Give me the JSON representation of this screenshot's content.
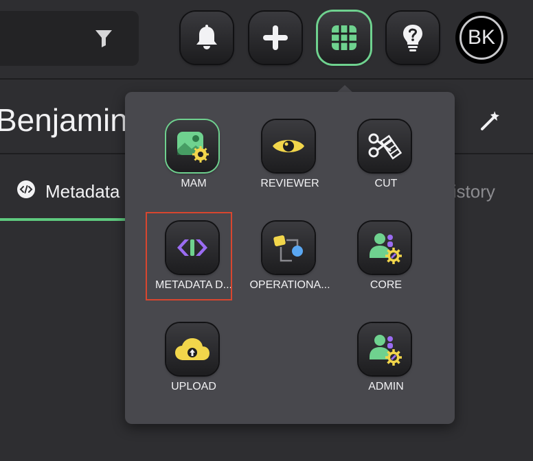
{
  "topbar": {
    "filter_icon": "filter-icon",
    "buttons": [
      {
        "name": "notifications-button",
        "icon": "bell-icon"
      },
      {
        "name": "add-button",
        "icon": "plus-icon"
      },
      {
        "name": "apps-launcher-button",
        "icon": "grid-icon",
        "active": true
      },
      {
        "name": "help-button",
        "icon": "lightbulb-question-icon"
      }
    ],
    "avatar_initials": "BK"
  },
  "header": {
    "user_name": "Benjamin",
    "wand_icon": "magic-wand-icon"
  },
  "tabs": {
    "metadata_label": "Metadata",
    "history_label": "History"
  },
  "launcher": {
    "apps": [
      {
        "label": "MAM",
        "icon": "mam-icon",
        "active": true
      },
      {
        "label": "REVIEWER",
        "icon": "eye-icon"
      },
      {
        "label": "CUT",
        "icon": "scissors-film-icon"
      },
      {
        "label": "METADATA D...",
        "icon": "code-brackets-icon",
        "highlighted": true
      },
      {
        "label": "OPERATIONA...",
        "icon": "workflow-icon"
      },
      {
        "label": "CORE",
        "icon": "user-gear-icon"
      },
      {
        "label": "UPLOAD",
        "icon": "cloud-upload-icon"
      },
      {
        "label": "ADMIN",
        "icon": "user-gear-icon"
      }
    ]
  },
  "colors": {
    "accent_green": "#6fd28f",
    "highlight_red": "#d9462f",
    "icon_yellow": "#f2d64b",
    "icon_purple": "#9b6cf2"
  }
}
